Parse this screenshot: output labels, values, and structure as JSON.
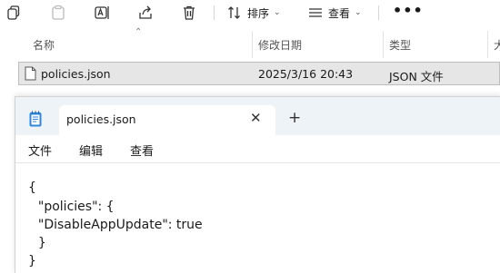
{
  "explorer": {
    "toolbar": {
      "icons": [
        "copy-icon",
        "paste-icon",
        "rename-icon",
        "share-icon",
        "delete-icon"
      ],
      "sort_label": "排序",
      "view_label": "查看",
      "more_label": "•••"
    },
    "columns": {
      "name": "名称",
      "date_modified": "修改日期",
      "type": "类型",
      "size": "大"
    },
    "selected_file": {
      "name": "policies.json",
      "date_modified": "2025/3/16 20:43",
      "type": "JSON 文件"
    }
  },
  "notepad": {
    "tab_title": "policies.json",
    "close_glyph": "✕",
    "new_tab_glyph": "+",
    "menu": {
      "file": "文件",
      "edit": "编辑",
      "view": "查看"
    },
    "content_lines": [
      "{",
      "  \"policies\": {",
      "  \"DisableAppUpdate\": true",
      "  }",
      "}"
    ]
  },
  "colors": {
    "selected_row_bg": "#e6e6e6",
    "tabstrip_bg": "#eef3f7",
    "notepad_icon": "#2e86de"
  }
}
